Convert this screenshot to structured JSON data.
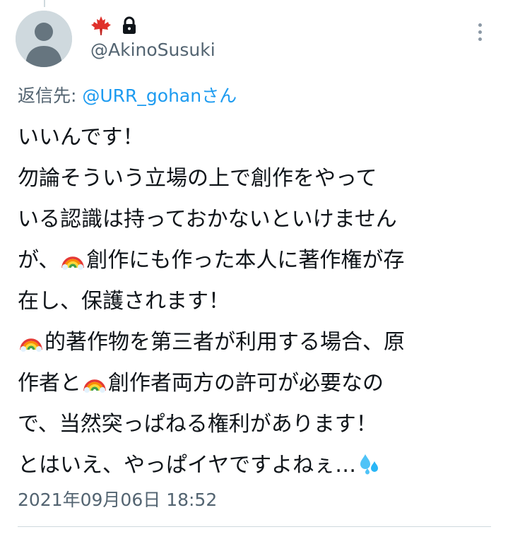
{
  "author": {
    "display_name_icons": [
      "maple-leaf-icon",
      "lock-icon"
    ],
    "handle": "@AkinoSusuki"
  },
  "reply": {
    "prefix": "返信先: ",
    "mention": "@URR_gohanさん"
  },
  "tweet": {
    "lines": [
      [
        "いいんです！"
      ],
      [
        "勿論そういう立場の上で創作をやって"
      ],
      [
        "いる認識は持っておかないといけません"
      ],
      [
        "が、",
        "{rainbow}",
        "創作にも作った本人に著作権が存"
      ],
      [
        "在し、保護されます！"
      ],
      [
        "{rainbow}",
        "的著作物を第三者が利用する場合、原"
      ],
      [
        "作者と",
        "{rainbow}",
        "創作者両方の許可が必要なの"
      ],
      [
        "で、当然突っぱねる権利があります！"
      ],
      [
        "とはいえ、やっぱイヤですよねぇ…",
        "{sweat}"
      ]
    ]
  },
  "timestamp": "2021年09月06日 18:52",
  "colors": {
    "accent": "#1d9bf0",
    "secondary_text": "#536471",
    "divider": "#cfd9de"
  }
}
